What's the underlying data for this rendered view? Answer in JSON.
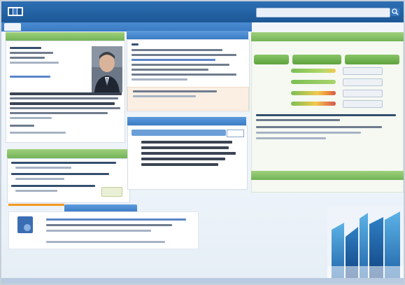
{
  "header": {
    "title": "",
    "search_placeholder": "",
    "brand_icon": "logo-mark-icon",
    "search_icon": "magnifier-icon"
  },
  "nav": {
    "tabs": [
      {
        "label": ""
      },
      {
        "label": ""
      },
      {
        "label": ""
      },
      {
        "label": ""
      },
      {
        "label": ""
      },
      {
        "label": ""
      },
      {
        "label": ""
      }
    ]
  },
  "profile": {
    "heading": "",
    "link_text": ""
  },
  "left_lower": {
    "heading": "",
    "sub_heading": "",
    "button_label": ""
  },
  "bottom": {
    "tab_label": "",
    "doc_icon": "document-icon"
  },
  "middle": {
    "heading": "",
    "panel_heading": "",
    "dropdown_value": ""
  },
  "right": {
    "heading": "",
    "tabs": [
      {
        "label": ""
      },
      {
        "label": ""
      },
      {
        "label": ""
      }
    ],
    "rows": [
      {
        "label": "",
        "button": ""
      },
      {
        "label": "",
        "button": ""
      },
      {
        "label": "",
        "button": ""
      },
      {
        "label": "",
        "button": ""
      }
    ],
    "footer_heading": ""
  },
  "colors": {
    "brand_blue": "#1d5796",
    "nav_blue": "#3a7bc4",
    "accent_green": "#73b357",
    "accent_orange": "#f29a1f",
    "panel_bg": "#ffffff"
  }
}
